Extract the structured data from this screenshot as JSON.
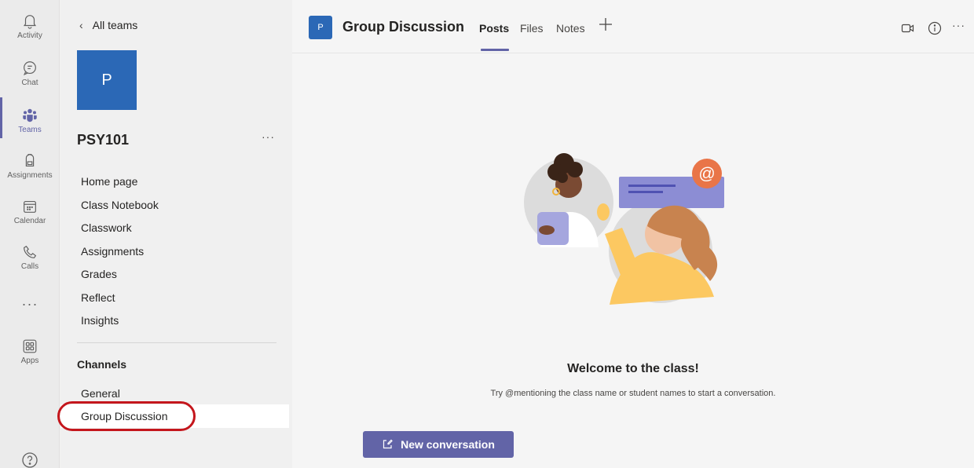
{
  "rail": {
    "items": [
      {
        "label": "Activity",
        "icon": "bell-icon"
      },
      {
        "label": "Chat",
        "icon": "chat-icon"
      },
      {
        "label": "Teams",
        "icon": "teams-icon"
      },
      {
        "label": "Assignments",
        "icon": "backpack-icon"
      },
      {
        "label": "Calendar",
        "icon": "calendar-icon"
      },
      {
        "label": "Calls",
        "icon": "phone-icon"
      },
      {
        "label": "Apps",
        "icon": "apps-icon"
      }
    ],
    "more": "···",
    "active_item": "Teams"
  },
  "team": {
    "back_label": "All teams",
    "avatar_letter": "P",
    "name": "PSY101",
    "more": "···",
    "nav": [
      "Home page",
      "Class Notebook",
      "Classwork",
      "Assignments",
      "Grades",
      "Reflect",
      "Insights"
    ],
    "channels_label": "Channels",
    "channels": [
      "General",
      "Group Discussion"
    ],
    "selected_channel": "Group Discussion"
  },
  "header": {
    "avatar_letter": "P",
    "title": "Group Discussion",
    "tabs": [
      "Posts",
      "Files",
      "Notes"
    ],
    "active_tab": "Posts",
    "more": "···"
  },
  "main": {
    "welcome_title": "Welcome to the class!",
    "welcome_sub": "Try @mentioning the class name or student names to start a conversation.",
    "new_conversation": "New conversation"
  },
  "colors": {
    "accent": "#6264a7",
    "team_avatar": "#2b68b6",
    "highlight": "#c4161c"
  }
}
